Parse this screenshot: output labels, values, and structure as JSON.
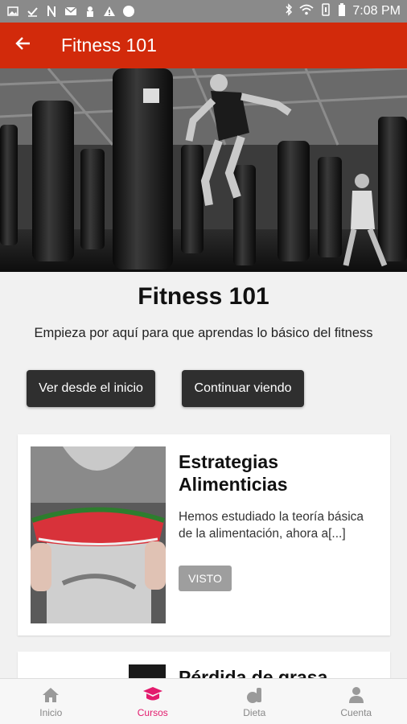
{
  "status_bar": {
    "time": "7:08 PM",
    "icons": [
      "image-icon",
      "check-icon",
      "n-icon",
      "mail-icon",
      "person-icon",
      "warning-icon",
      "circle-icon",
      "bluetooth-icon",
      "wifi-icon",
      "vibrate-icon",
      "battery-icon"
    ]
  },
  "app_bar": {
    "title": "Fitness 101",
    "back_icon": "arrow-left-icon",
    "color": "#d22a0b"
  },
  "course": {
    "title": "Fitness 101",
    "subtitle": "Empieza por aquí para que aprendas lo básico del fitness",
    "start_button": "Ver desde el inicio",
    "continue_button": "Continuar viendo"
  },
  "lessons": [
    {
      "title": "Estrategias Alimenticias",
      "description": "Hemos estudiado la teoría básica de la alimentación, ahora a[...]",
      "status": "VISTO"
    },
    {
      "title": "Pérdida de grasa"
    }
  ],
  "bottom_nav": {
    "items": [
      {
        "label": "Inicio",
        "icon": "home-icon"
      },
      {
        "label": "Cursos",
        "icon": "courses-icon"
      },
      {
        "label": "Dieta",
        "icon": "diet-icon"
      },
      {
        "label": "Cuenta",
        "icon": "account-icon"
      }
    ],
    "active": "Cursos",
    "active_color": "#e31b6d"
  }
}
